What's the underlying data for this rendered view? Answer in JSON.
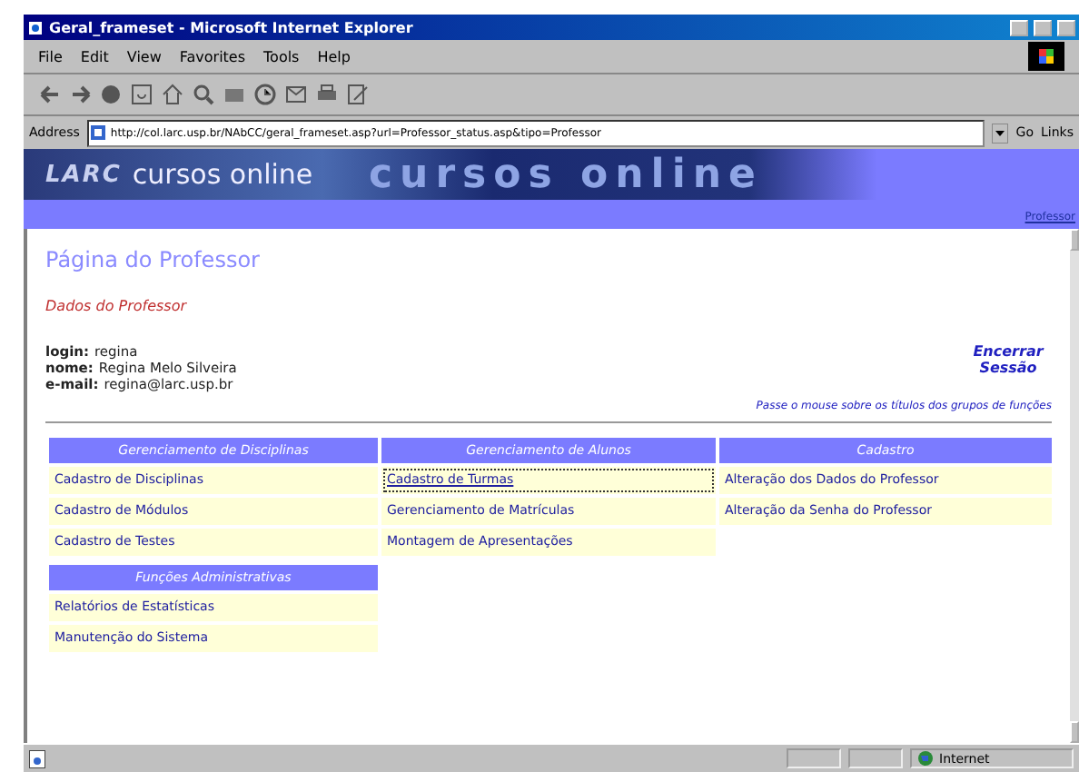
{
  "window": {
    "title": "Geral_frameset - Microsoft Internet Explorer"
  },
  "menu": [
    "File",
    "Edit",
    "View",
    "Favorites",
    "Tools",
    "Help"
  ],
  "address": {
    "label": "Address",
    "value": "http://col.larc.usp.br/NAbCC/geral_frameset.asp?url=Professor_status.asp&tipo=Professor",
    "go": "Go",
    "links": "Links"
  },
  "banner": {
    "logo": "LARC",
    "title": "cursos online",
    "backdrop_text": "cursos online",
    "user_link": "Professor"
  },
  "page": {
    "heading": "Página do Professor",
    "section": "Dados do Professor",
    "fields": [
      {
        "label": "login:",
        "value": "regina"
      },
      {
        "label": "nome:",
        "value": "Regina Melo Silveira"
      },
      {
        "label": "e-mail:",
        "value": "regina@larc.usp.br"
      }
    ],
    "logout": "Encerrar Sessão",
    "hint": "Passe o mouse sobre os títulos dos grupos de funções"
  },
  "columns": [
    [
      {
        "title": "Gerenciamento de Disciplinas",
        "items": [
          {
            "label": "Cadastro de Disciplinas",
            "focused": false
          },
          {
            "label": "Cadastro de Módulos",
            "focused": false
          },
          {
            "label": "Cadastro de Testes",
            "focused": false
          }
        ]
      },
      {
        "title": "Funções Administrativas",
        "items": [
          {
            "label": "Relatórios de Estatísticas",
            "focused": false
          },
          {
            "label": "Manutenção do Sistema",
            "focused": false
          }
        ]
      }
    ],
    [
      {
        "title": "Gerenciamento de Alunos",
        "items": [
          {
            "label": "Cadastro de Turmas",
            "focused": true
          },
          {
            "label": "Gerenciamento de Matrículas",
            "focused": false
          },
          {
            "label": "Montagem de Apresentações",
            "focused": false
          }
        ]
      }
    ],
    [
      {
        "title": "Cadastro",
        "items": [
          {
            "label": "Alteração dos Dados do Professor",
            "focused": false
          },
          {
            "label": "Alteração da Senha do Professor",
            "focused": false
          }
        ]
      }
    ]
  ],
  "status_bar": {
    "zone": "Internet"
  }
}
